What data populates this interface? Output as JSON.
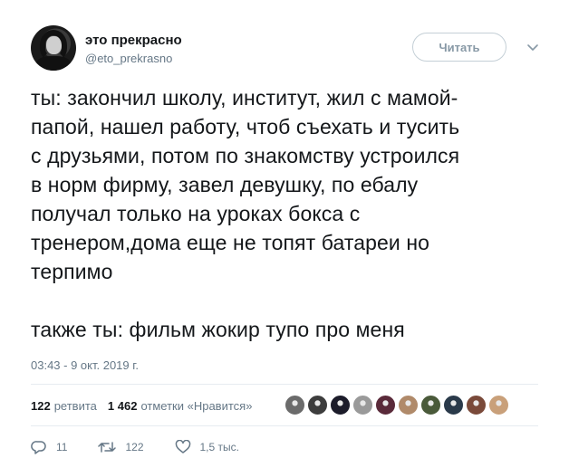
{
  "author": {
    "name": "это прекрасно",
    "handle": "@eto_prekrasno"
  },
  "follow_button": {
    "label": "Читать"
  },
  "tweet": {
    "text": "ты: закончил школу, институт, жил с мамой-\nпапой, нашел работу, чтоб съехать и тусить\nс друзьями, потом по знакомству устроился\nв норм фирму, завел девушку, по ебалу\nполучал только на уроках бокса с\nтренером,дома еще не топят батареи но\nтерпимо\n\nтакже ты: фильм жокир тупо про меня",
    "timestamp": "03:43 - 9 окт. 2019 г."
  },
  "stats": {
    "retweets_count": "122",
    "retweets_label": "ретвита",
    "likes_count": "1 462",
    "likes_label": "отметки «Нравится»"
  },
  "likers": [
    {
      "icon": "liker-avatar",
      "color": "#6b6b6b"
    },
    {
      "icon": "liker-avatar",
      "color": "#3d3d3d"
    },
    {
      "icon": "liker-avatar",
      "color": "#1c1c2a"
    },
    {
      "icon": "liker-avatar",
      "color": "#9a9a9a"
    },
    {
      "icon": "liker-avatar",
      "color": "#5a2a3a"
    },
    {
      "icon": "liker-avatar",
      "color": "#b08a6a"
    },
    {
      "icon": "liker-avatar",
      "color": "#4a5a3a"
    },
    {
      "icon": "liker-avatar",
      "color": "#2a3a4a"
    },
    {
      "icon": "liker-avatar",
      "color": "#7a4a3a"
    },
    {
      "icon": "liker-avatar",
      "color": "#c9a07a"
    }
  ],
  "actions": {
    "reply_count": "11",
    "retweet_count": "122",
    "like_count": "1,5 тыс."
  },
  "colors": {
    "text": "#14171a",
    "secondary": "#657786",
    "divider": "#e6ecf0"
  }
}
